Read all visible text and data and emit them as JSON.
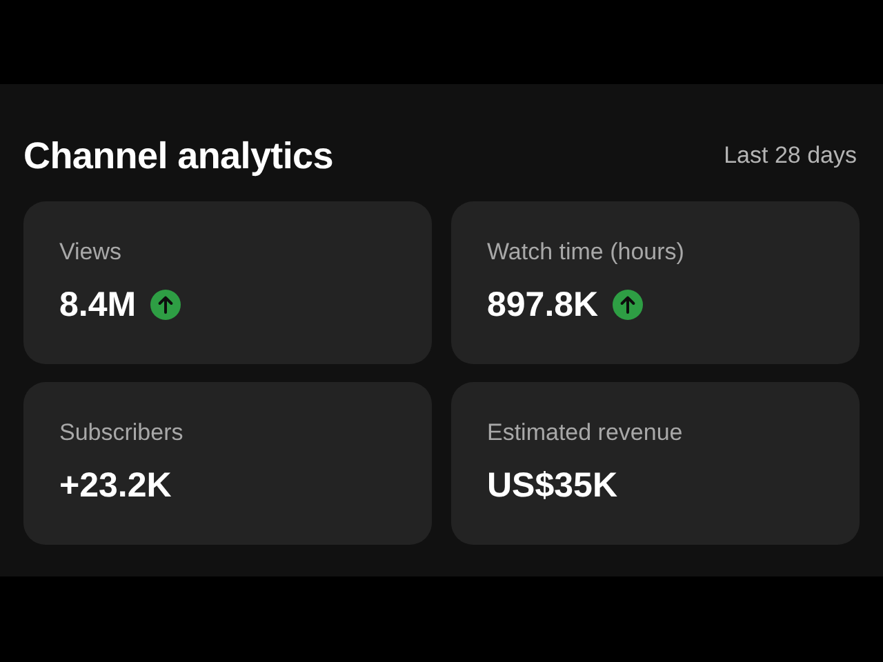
{
  "header": {
    "title": "Channel analytics",
    "period": "Last 28 days"
  },
  "cards": [
    {
      "label": "Views",
      "value": "8.4M",
      "trend_up": true
    },
    {
      "label": "Watch time (hours)",
      "value": "897.8K",
      "trend_up": true
    },
    {
      "label": "Subscribers",
      "value": "+23.2K",
      "trend_up": false
    },
    {
      "label": "Estimated revenue",
      "value": "US$35K",
      "trend_up": false
    }
  ]
}
